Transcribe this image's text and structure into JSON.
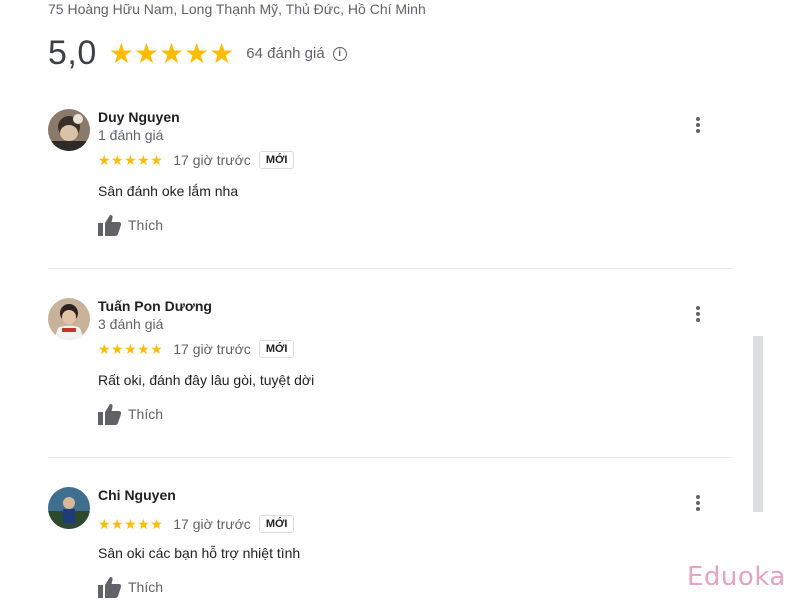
{
  "place": {
    "address": "75 Hoàng Hữu Nam, Long Thạnh Mỹ, Thủ Đức, Hồ Chí Minh"
  },
  "summary": {
    "score": "5,0",
    "stars": "★★★★★",
    "count": "64 đánh giá",
    "info_icon": "i"
  },
  "reviews": [
    {
      "author": "Duy Nguyen",
      "meta": "1 đánh giá",
      "stars": "★★★★★",
      "time": "17 giờ trước",
      "badge": "MỚI",
      "text": "Sân đánh oke lắm nha",
      "like_label": "Thích"
    },
    {
      "author": "Tuấn Pon Dương",
      "meta": "3 đánh giá",
      "stars": "★★★★★",
      "time": "17 giờ trước",
      "badge": "MỚI",
      "text": "Rất oki, đánh đây lâu gòi, tuyệt dời",
      "like_label": "Thích"
    },
    {
      "author": "Chi Nguyen",
      "stars": "★★★★★",
      "time": "17 giờ trước",
      "badge": "MỚI",
      "text": "Sân oki các bạn hỗ trợ nhiệt tình",
      "like_label": "Thích"
    }
  ],
  "watermark": "Eduoka",
  "colors": {
    "star": "#fbbc04",
    "text": "#202124",
    "muted": "#5f6368",
    "watermark": "#e5a3c8"
  }
}
